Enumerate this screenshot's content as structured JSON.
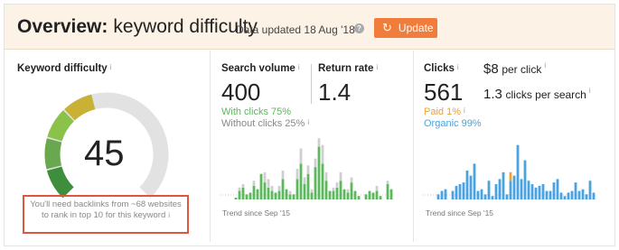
{
  "header": {
    "title_bold": "Overview:",
    "title_rest": "keyword difficulty",
    "data_updated": "Data updated 18 Aug '18",
    "help_glyph": "?",
    "update_icon": "refresh-icon",
    "update_label": "Update"
  },
  "keyword_difficulty": {
    "label": "Keyword difficulty",
    "info": "i",
    "value": "45",
    "gauge_level": 45,
    "gauge_colors": [
      "#3d8f3d",
      "#6aa84f",
      "#8bc34a",
      "#c8b135"
    ],
    "note_line1": "You'll need backlinks from ~68 websites",
    "note_line2": "to rank in top 10 for this keyword",
    "note_info": "i"
  },
  "search_volume": {
    "label": "Search volume",
    "info": "i",
    "value": "400",
    "with_clicks": "With clicks 75%",
    "without_clicks": "Without clicks 25%",
    "without_info": "i",
    "return_rate_label": "Return rate",
    "return_rate_info": "i",
    "return_rate_value": "1.4",
    "trend": "Trend since Sep '15"
  },
  "clicks": {
    "label": "Clicks",
    "info": "i",
    "value": "561",
    "cpc": "$8",
    "cpc_label": "per click",
    "cpc_info": "i",
    "cps": "1.3",
    "cps_label": "clicks per search",
    "cps_info": "i",
    "paid": "Paid 1%",
    "paid_info": "i",
    "organic": "Organic 99%",
    "trend": "Trend since Sep '15"
  },
  "colors": {
    "green_bar": "#5cb85c",
    "gray_bar": "#cfcfcf",
    "blue_bar": "#4aa3df",
    "orange_bar": "#f0a030",
    "green_text": "#5cb85c",
    "orange_text": "#f0a030",
    "blue_text": "#4aa3df",
    "accent": "#f07d3b"
  },
  "chart_data": [
    {
      "type": "bar",
      "series": [
        {
          "name": "With clicks",
          "values": [
            0,
            0,
            0,
            0,
            1,
            5,
            7,
            3,
            4,
            8,
            6,
            15,
            10,
            7,
            5,
            4,
            5,
            12,
            6,
            3,
            3,
            12,
            21,
            9,
            15,
            4,
            19,
            31,
            21,
            11,
            5,
            5,
            7,
            11,
            6,
            4,
            10,
            5,
            2,
            0,
            3,
            5,
            4,
            5,
            2,
            0,
            9,
            6
          ]
        },
        {
          "name": "Without clicks",
          "values": [
            0,
            0,
            0,
            0,
            0,
            2,
            2,
            0,
            0,
            3,
            0,
            0,
            6,
            5,
            3,
            0,
            3,
            5,
            0,
            2,
            0,
            6,
            9,
            4,
            5,
            2,
            5,
            5,
            11,
            5,
            0,
            2,
            3,
            5,
            0,
            2,
            3,
            0,
            0,
            0,
            0,
            0,
            0,
            3,
            0,
            0,
            2,
            0
          ]
        }
      ],
      "ylim": [
        0,
        35
      ],
      "xlabel": "Trend since Sep '15"
    },
    {
      "type": "bar",
      "series": [
        {
          "name": "Organic",
          "values": [
            0,
            0,
            0,
            0,
            3,
            5,
            6,
            0,
            5,
            8,
            9,
            10,
            17,
            14,
            21,
            5,
            6,
            3,
            11,
            2,
            9,
            12,
            16,
            3,
            11,
            14,
            32,
            12,
            23,
            11,
            9,
            7,
            8,
            9,
            5,
            5,
            10,
            12,
            4,
            2,
            4,
            5,
            10,
            5,
            6,
            3,
            11,
            4
          ]
        },
        {
          "name": "Paid",
          "values": [
            0,
            0,
            0,
            0,
            0,
            0,
            0,
            0,
            0,
            0,
            0,
            0,
            0,
            0,
            0,
            0,
            0,
            0,
            0,
            0,
            0,
            0,
            0,
            0,
            5,
            0,
            0,
            0,
            0,
            0,
            0,
            0,
            0,
            0,
            0,
            0,
            0,
            0,
            0,
            0,
            0,
            0,
            0,
            0,
            0,
            0,
            0,
            0
          ]
        }
      ],
      "ylim": [
        0,
        35
      ],
      "xlabel": "Trend since Sep '15"
    }
  ]
}
